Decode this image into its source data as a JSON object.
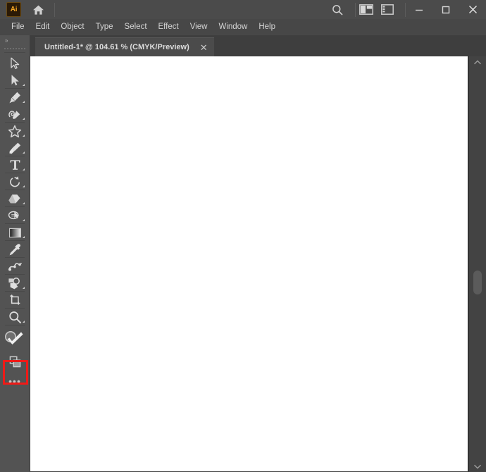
{
  "app": {
    "name": "Adobe Illustrator",
    "logo_text": "Ai",
    "logo_color": "#f5a623"
  },
  "titlebar": {
    "home_icon": "home-icon",
    "search_icon": "search-icon",
    "arrange_documents_icon": "arrange-documents-icon",
    "workspace_switcher_icon": "workspace-switcher-icon",
    "minimize_label": "–",
    "maximize_label": "□",
    "close_label": "✕"
  },
  "menubar": {
    "items": [
      {
        "label": "File"
      },
      {
        "label": "Edit"
      },
      {
        "label": "Object"
      },
      {
        "label": "Type"
      },
      {
        "label": "Select"
      },
      {
        "label": "Effect"
      },
      {
        "label": "View"
      },
      {
        "label": "Window"
      },
      {
        "label": "Help"
      }
    ]
  },
  "tabbar": {
    "tab": {
      "title": "Untitled-1* @ 104.61 % (CMYK/Preview)",
      "document_name": "Untitled-1*",
      "zoom": "104.61 %",
      "color_mode": "CMYK/Preview",
      "close_label": "✕"
    }
  },
  "toolbar": {
    "collapse_label": "»",
    "highlight_color": "#f01a17",
    "highlighted_tool": "fill-stroke-swatch",
    "tools": [
      {
        "name": "selection-tool",
        "label": "Selection Tool",
        "has_flyout": false
      },
      {
        "name": "direct-selection-tool",
        "label": "Direct Selection Tool",
        "has_flyout": true
      },
      {
        "name": "pen-tool",
        "label": "Pen Tool",
        "has_flyout": true
      },
      {
        "name": "curvature-tool",
        "label": "Curvature Tool",
        "has_flyout": true
      },
      {
        "name": "shape-tool",
        "label": "Shape Tool",
        "has_flyout": true
      },
      {
        "name": "paintbrush-tool",
        "label": "Paintbrush Tool",
        "has_flyout": true
      },
      {
        "name": "type-tool",
        "label": "Type Tool",
        "has_flyout": true
      },
      {
        "name": "rotate-tool",
        "label": "Rotate Tool",
        "has_flyout": true
      },
      {
        "name": "eraser-tool",
        "label": "Eraser Tool",
        "has_flyout": true
      },
      {
        "name": "free-transform-tool",
        "label": "Free Transform Tool",
        "has_flyout": false
      },
      {
        "name": "gradient-tool",
        "label": "Gradient Tool",
        "has_flyout": true
      },
      {
        "name": "eyedropper-tool",
        "label": "Eyedropper Tool",
        "has_flyout": false
      },
      {
        "name": "blend-tool",
        "label": "Blend Tool",
        "has_flyout": false
      },
      {
        "name": "symbol-sprayer-tool",
        "label": "Symbol Sprayer Tool",
        "has_flyout": true
      },
      {
        "name": "artboard-tool",
        "label": "Artboard Tool",
        "has_flyout": false
      },
      {
        "name": "zoom-tool",
        "label": "Zoom Tool",
        "has_flyout": true
      }
    ],
    "bottom_tools": [
      {
        "name": "fill-stroke-swatch",
        "label": "Fill and Stroke"
      },
      {
        "name": "screen-mode-tool",
        "label": "Change Screen Mode"
      },
      {
        "name": "edit-toolbar-button",
        "label": "Edit Toolbar",
        "glyph": "•••"
      }
    ]
  },
  "canvas": {
    "artboard_color": "#ffffff",
    "background_color": "#3e3e3e"
  },
  "scrollbar": {
    "up_arrow_icon": "chevron-up-icon",
    "down_arrow_icon": "chevron-down-icon"
  }
}
